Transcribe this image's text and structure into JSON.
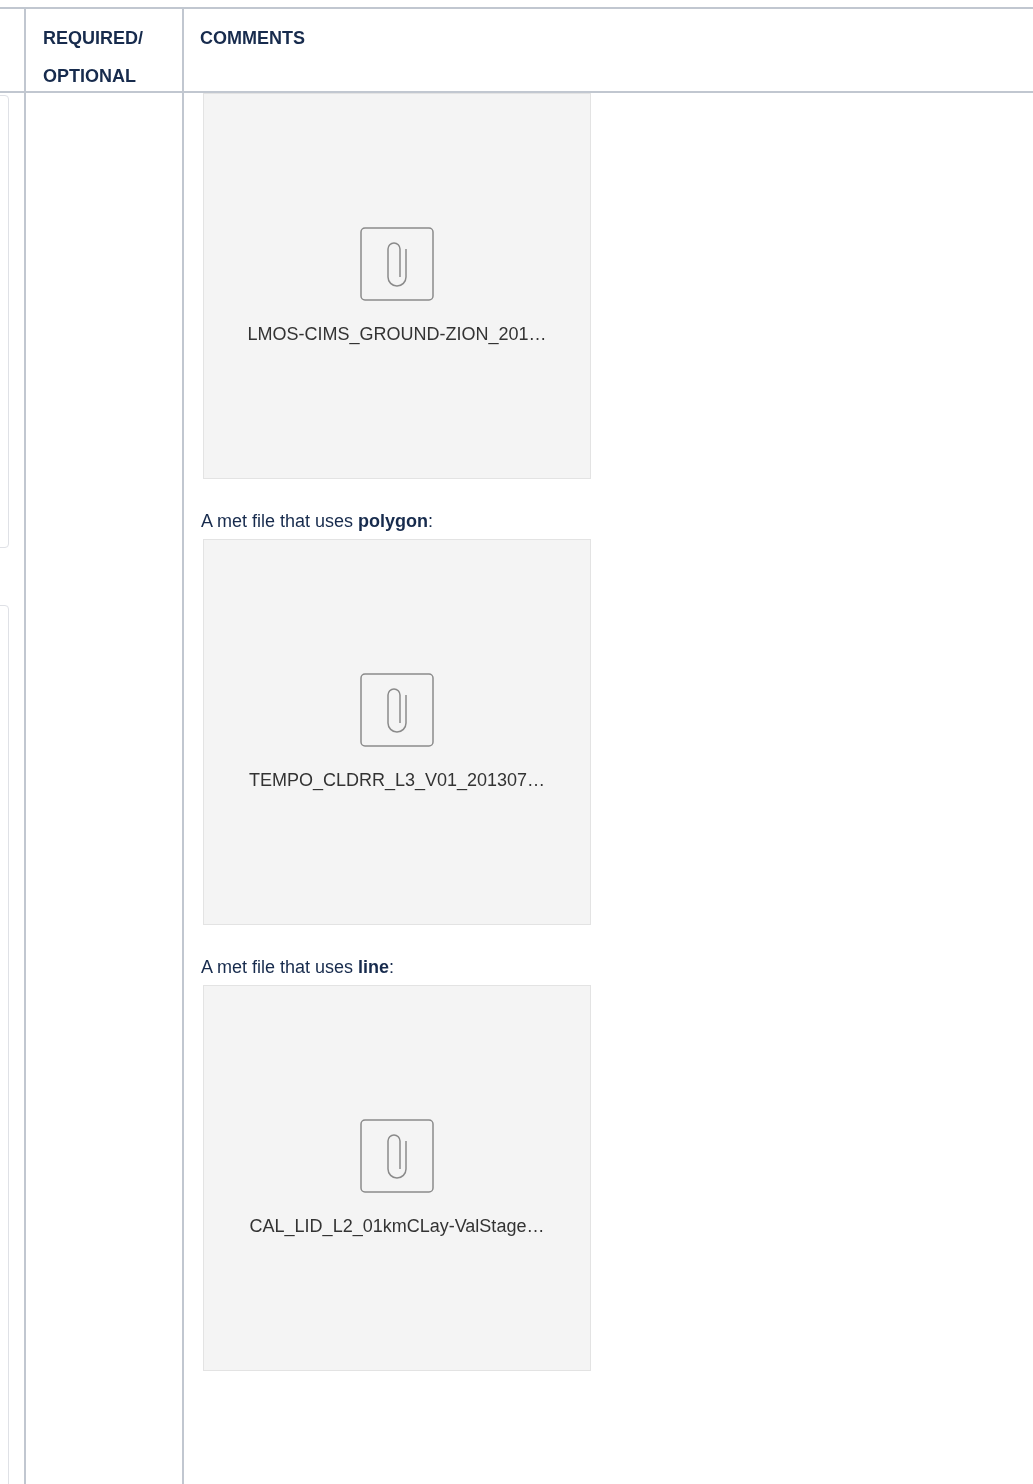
{
  "table": {
    "columns": [
      {
        "label": "REQUIRED/ OPTIONAL"
      },
      {
        "label": "COMMENTS"
      }
    ],
    "rows": [
      {
        "cells": [
          {},
          {},
          {
            "items": [
              {
                "kind": "attachment",
                "filename": "LMOS-CIMS_GROUND-ZION_201…"
              },
              {
                "kind": "paragraph",
                "text": "A met file that uses **polygon**:"
              },
              {
                "kind": "attachment",
                "filename": "TEMPO_CLDRR_L3_V01_201307…"
              },
              {
                "kind": "paragraph",
                "text": "A met file that uses **line**:"
              },
              {
                "kind": "attachment",
                "filename": "CAL_LID_L2_01kmCLay-ValStage…"
              }
            ]
          }
        ]
      }
    ]
  }
}
